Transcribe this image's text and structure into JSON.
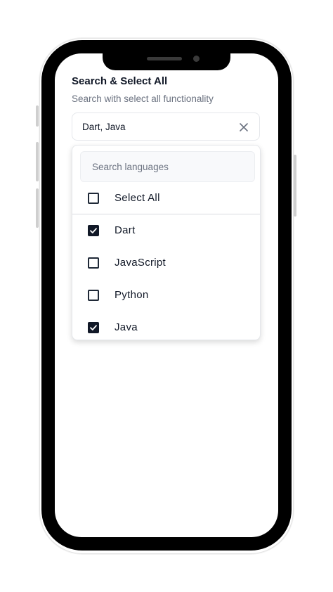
{
  "title": "Search & Select All",
  "subtitle": "Search with select all functionality",
  "select": {
    "value": "Dart, Java",
    "clear_icon": "close-icon"
  },
  "dropdown": {
    "search_placeholder": "Search languages",
    "select_all": {
      "label": "Select All",
      "checked": false
    },
    "options": [
      {
        "label": "Dart",
        "checked": true
      },
      {
        "label": "JavaScript",
        "checked": false
      },
      {
        "label": "Python",
        "checked": false
      },
      {
        "label": "Java",
        "checked": true
      }
    ]
  },
  "colors": {
    "checkbox_checked": "#111827",
    "text_primary": "#111827",
    "text_secondary": "#6b7280"
  }
}
